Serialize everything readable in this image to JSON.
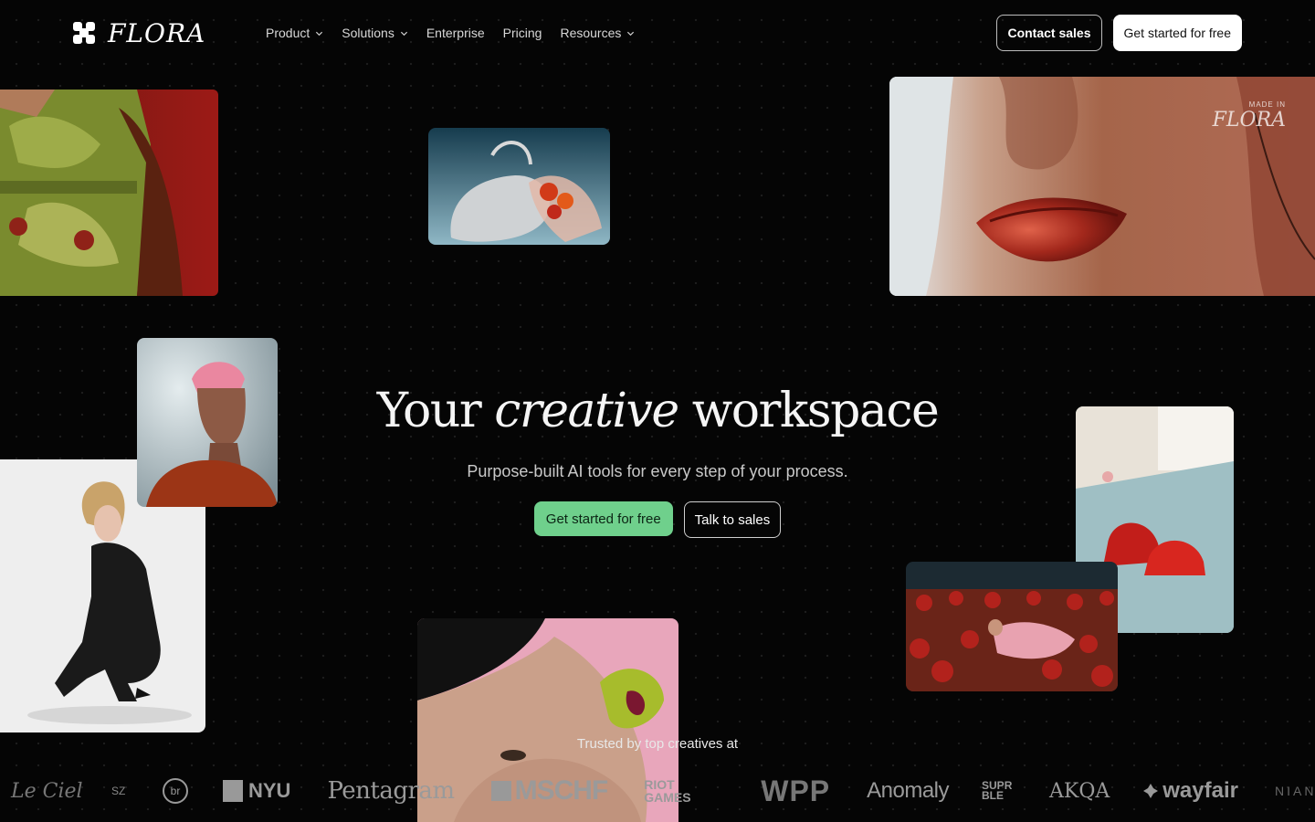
{
  "nav": {
    "logo_text": "FLORA",
    "menu": [
      {
        "label": "Product",
        "has_dropdown": true
      },
      {
        "label": "Solutions",
        "has_dropdown": true
      },
      {
        "label": "Enterprise",
        "has_dropdown": false
      },
      {
        "label": "Pricing",
        "has_dropdown": false
      },
      {
        "label": "Resources",
        "has_dropdown": true
      }
    ],
    "contact_label": "Contact sales",
    "get_started_label": "Get started for free"
  },
  "hero": {
    "title_part1": "Your",
    "title_italic": "creative",
    "title_part2": "workspace",
    "subtitle": "Purpose-built AI tools for every step of your process.",
    "primary_cta": "Get started for free",
    "secondary_cta": "Talk to sales"
  },
  "gallery": {
    "watermark_small": "MADE IN",
    "watermark_logo": "FLORA"
  },
  "trusted": {
    "heading": "Trusted by top creatives at",
    "brands": [
      "Le Ciel",
      "SZ",
      "br",
      "NYU",
      "Pentagram",
      "MSCHF",
      "RIOT GAMES",
      "WPP",
      "Anomaly",
      "SUPRBLE",
      "AKQA",
      "wayfair",
      "NIANTIC"
    ]
  },
  "colors": {
    "background": "#050505",
    "accent_green": "#6fd08c",
    "text_primary": "#f5f5f5"
  }
}
